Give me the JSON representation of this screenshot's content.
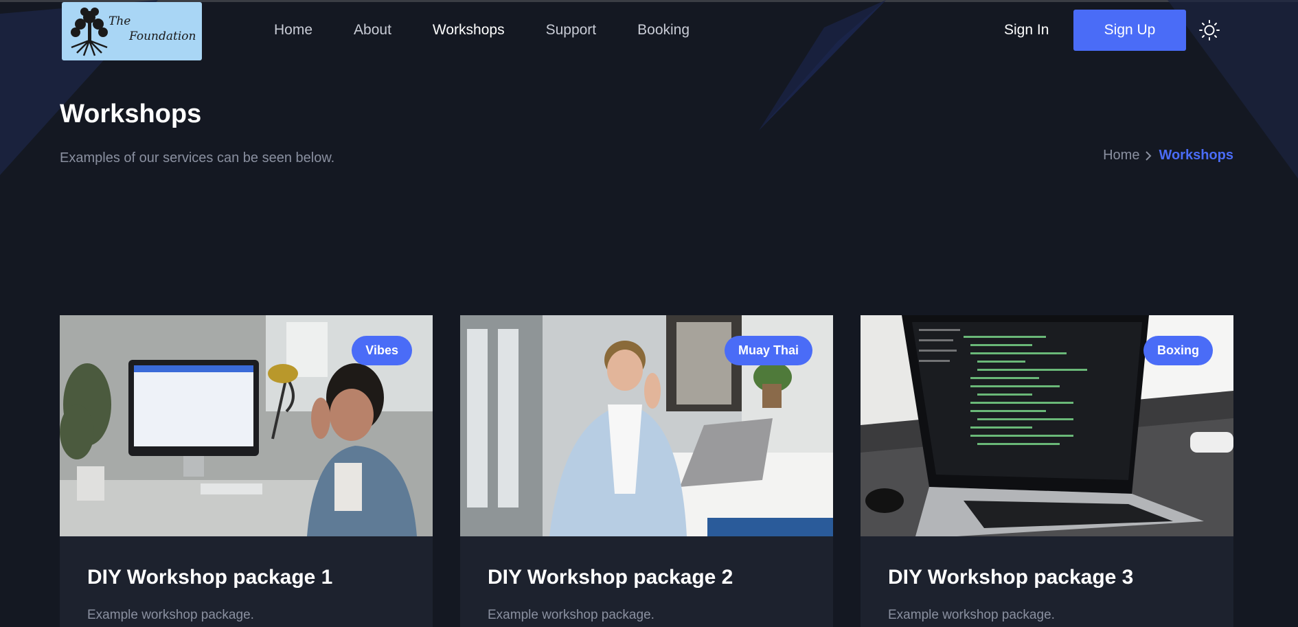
{
  "brand": {
    "logo_line1": "The",
    "logo_line2": "Foundation"
  },
  "nav": {
    "items": [
      {
        "label": "Home"
      },
      {
        "label": "About"
      },
      {
        "label": "Workshops",
        "active": true
      },
      {
        "label": "Support"
      },
      {
        "label": "Booking"
      }
    ]
  },
  "auth": {
    "sign_in": "Sign In",
    "sign_up": "Sign Up"
  },
  "theme_toggle": {
    "icon": "sun-icon"
  },
  "page": {
    "title": "Workshops",
    "subtitle": "Examples of our services can be seen below.",
    "breadcrumb": {
      "home": "Home",
      "current": "Workshops"
    }
  },
  "cards": [
    {
      "tag": "Vibes",
      "title": "DIY Workshop package 1",
      "description": "Example workshop package."
    },
    {
      "tag": "Muay Thai",
      "title": "DIY Workshop package 2",
      "description": "Example workshop package."
    },
    {
      "tag": "Boxing",
      "title": "DIY Workshop package 3",
      "description": "Example workshop package."
    }
  ],
  "colors": {
    "background": "#141822",
    "accent": "#4a6cf7",
    "card": "#1d222e",
    "muted": "#8a90a0"
  }
}
